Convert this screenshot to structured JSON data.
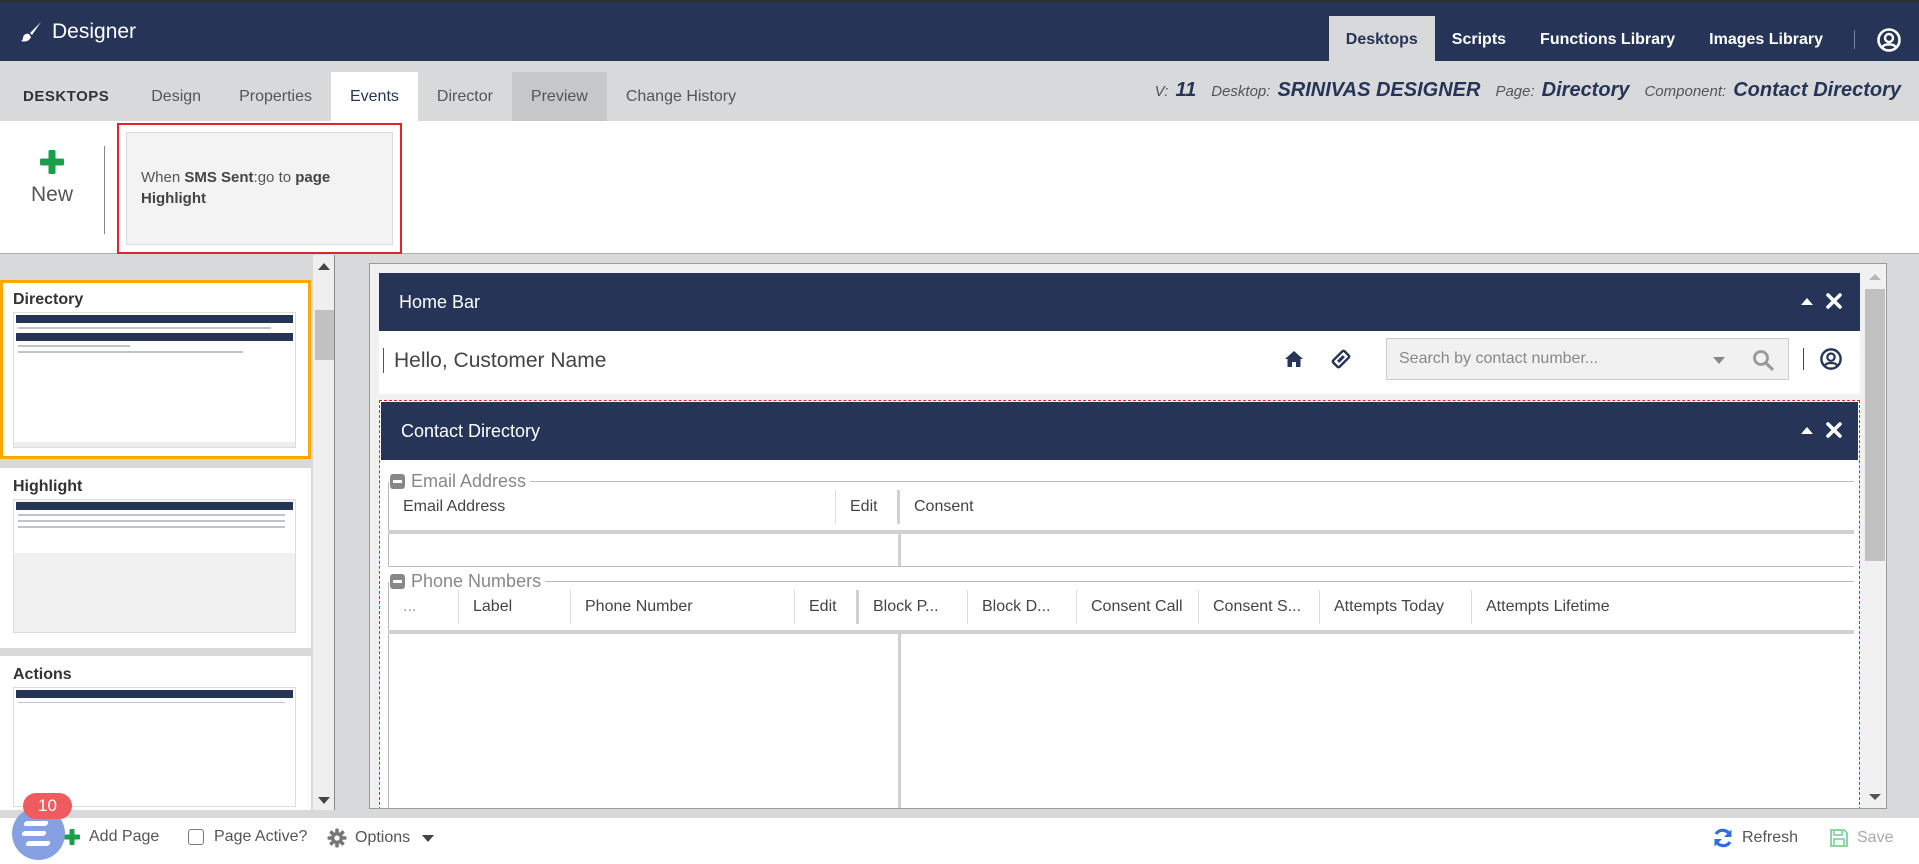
{
  "app": {
    "title": "Designer",
    "brand_icon": "paintbrush-icon"
  },
  "topnav": {
    "items": [
      {
        "label": "Desktops",
        "active": true
      },
      {
        "label": "Scripts",
        "active": false
      },
      {
        "label": "Functions Library",
        "active": false
      },
      {
        "label": "Images Library",
        "active": false
      }
    ],
    "user_icon": "user-circle-icon"
  },
  "subnav": {
    "section_label": "DESKTOPS",
    "tabs": [
      {
        "label": "Design",
        "state": "normal"
      },
      {
        "label": "Properties",
        "state": "normal"
      },
      {
        "label": "Events",
        "state": "active"
      },
      {
        "label": "Director",
        "state": "normal"
      },
      {
        "label": "Preview",
        "state": "dim"
      },
      {
        "label": "Change History",
        "state": "normal"
      }
    ],
    "context": {
      "version_label": "V:",
      "version": "11",
      "desktop_label": "Desktop:",
      "desktop": "SRINIVAS DESIGNER",
      "page_label": "Page:",
      "page": "Directory",
      "component_label": "Component:",
      "component": "Contact Directory"
    }
  },
  "events": {
    "new_label": "New",
    "cards": [
      {
        "prefix": "When",
        "trigger": "SMS Sent",
        "action": ":go to",
        "target_type": "page",
        "target": "Highlight"
      }
    ]
  },
  "pages": {
    "items": [
      {
        "title": "Directory",
        "selected": true
      },
      {
        "title": "Highlight",
        "selected": false
      },
      {
        "title": "Actions",
        "selected": false
      }
    ]
  },
  "canvas": {
    "home_bar": {
      "title": "Home Bar",
      "greeting": "Hello, Customer Name",
      "search_placeholder": "Search by contact number..."
    },
    "contact_directory": {
      "title": "Contact Directory",
      "email_section": {
        "legend": "Email Address",
        "columns": [
          "Email Address",
          "Edit",
          "Consent"
        ]
      },
      "phone_section": {
        "legend": "Phone Numbers",
        "columns": [
          "...",
          "Label",
          "Phone Number",
          "Edit",
          "Block P...",
          "Block D...",
          "Consent Call",
          "Consent S...",
          "Attempts Today",
          "Attempts Lifetime"
        ]
      }
    }
  },
  "footer": {
    "add_page": "Add Page",
    "page_active": "Page Active?",
    "page_active_checked": false,
    "options": "Options",
    "refresh": "Refresh",
    "save": "Save",
    "notification_count": "10"
  },
  "colors": {
    "navy": "#253457",
    "accent_green": "#1aa04a",
    "selection_orange": "#ffa800",
    "highlight_red": "#e2232f",
    "refresh_blue": "#2f6fd6",
    "badge_red": "#ef5b5f"
  }
}
